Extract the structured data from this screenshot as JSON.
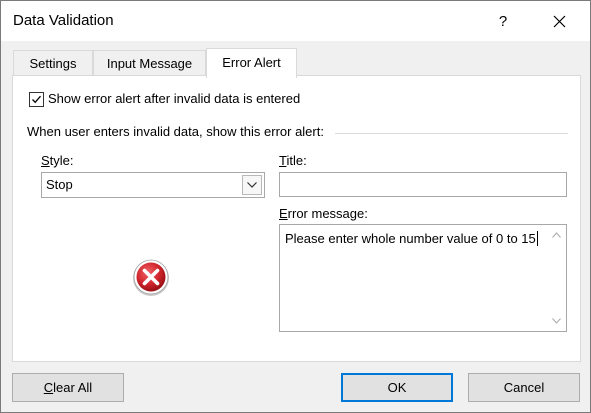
{
  "window": {
    "title": "Data Validation",
    "help_label": "?",
    "close_icon": "close-icon"
  },
  "tabs": [
    {
      "label": "Settings",
      "active": false
    },
    {
      "label": "Input Message",
      "active": false
    },
    {
      "label": "Error Alert",
      "active": true
    }
  ],
  "error_alert": {
    "show_alert_checked": true,
    "show_alert_label": "Show error alert after invalid data is entered",
    "group_label": "When user enters invalid data, show this error alert:",
    "style_label_accel": "S",
    "style_label_rest": "tyle:",
    "style_value": "Stop",
    "style_icon": "stop-error-icon",
    "title_label_accel": "T",
    "title_label_rest": "itle:",
    "title_value": "",
    "message_label_accel": "E",
    "message_label_rest": "rror message:",
    "message_value": "Please enter whole number value of 0 to 15"
  },
  "buttons": {
    "clear_all_accel": "C",
    "clear_all_rest": "lear All",
    "ok": "OK",
    "cancel": "Cancel"
  },
  "colors": {
    "accent": "#0078d7",
    "error_red": "#d1262d"
  }
}
